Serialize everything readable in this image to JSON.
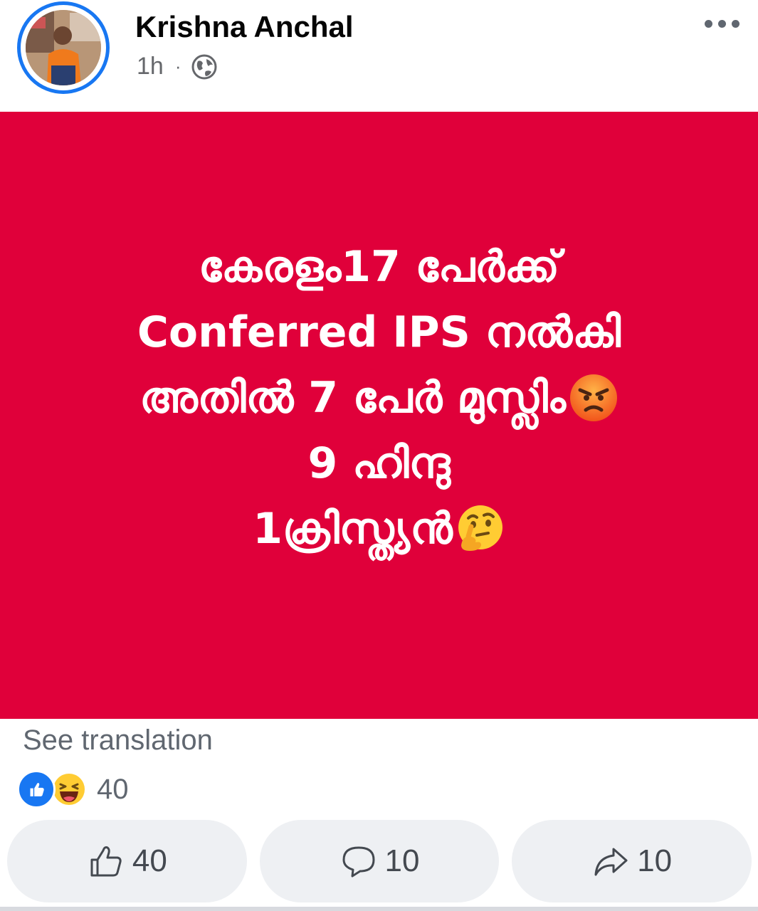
{
  "post": {
    "author": "Krishna Anchal",
    "time": "1h",
    "separator": "·",
    "privacy_icon": "globe-icon",
    "more_icon": "more-horizontal-icon"
  },
  "image": {
    "background": "#e0003a",
    "lines": [
      "കേരളം17 പേർക്ക്",
      "Conferred IPS നൽകി",
      "അതിൽ 7 പേർ മുസ്ലിം",
      "9 ഹിന്ദു",
      "1ക്രിസ്ത്യൻ"
    ],
    "line3_emoji": "angry-face-emoji",
    "line5_emoji": "thinking-face-emoji"
  },
  "see_translation": "See translation",
  "reactions": {
    "icons": [
      "like-reaction-icon",
      "haha-reaction-icon"
    ],
    "count": "40"
  },
  "actions": {
    "like": {
      "icon": "thumbs-up-icon",
      "count": "40"
    },
    "comment": {
      "icon": "comment-icon",
      "count": "10"
    },
    "share": {
      "icon": "share-icon",
      "count": "10"
    }
  },
  "colors": {
    "accent": "#1877f2",
    "secondary_text": "#65676b",
    "button_bg": "#eef0f3"
  }
}
